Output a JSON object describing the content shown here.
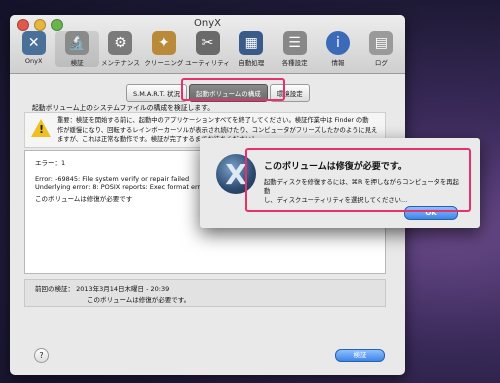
{
  "window": {
    "title": "OnyX"
  },
  "toolbar": {
    "items": [
      {
        "label": "OnyX",
        "icon": "onyx-logo-icon",
        "color": "#4a6f99"
      },
      {
        "label": "検証",
        "icon": "microscope-icon",
        "color": "#8a8a8a"
      },
      {
        "label": "メンテナンス",
        "icon": "gears-icon",
        "color": "#7a7a7a"
      },
      {
        "label": "クリーニング",
        "icon": "broom-icon",
        "color": "#b88a3a"
      },
      {
        "label": "ユーティリティ",
        "icon": "tools-icon",
        "color": "#6a6a6a"
      },
      {
        "label": "自動処理",
        "icon": "automation-icon",
        "color": "#3a5a8a"
      },
      {
        "label": "各種設定",
        "icon": "parameters-icon",
        "color": "#888888"
      },
      {
        "label": "情報",
        "icon": "info-icon",
        "color": "#3a6ab8"
      },
      {
        "label": "ログ",
        "icon": "log-icon",
        "color": "#9a9a9a"
      }
    ]
  },
  "tabs": [
    {
      "label": "S.M.A.R.T. 状況"
    },
    {
      "label": "起動ボリュームの構成"
    },
    {
      "label": "環境設定"
    }
  ],
  "description": "起動ボリューム上のシステムファイルの構成を検証します。",
  "warning": {
    "line1": "重要：検証を開始する前に、起動中のアプリケーションすべてを終了してください。検証作業中は Finder の動",
    "line2": "作が緩慢になり、回転するレインボーカーソルが表示され続けたり、コンピュータがフリーズしたかのように見え",
    "line3": "ますが、これは正常な動作です。検証が完了するまでお待ちください！"
  },
  "log": {
    "line1": "エラー：1",
    "line2": "Error: -69845: File system verify or repair failed",
    "line3": "Underlying error: 8: POSIX reports: Exec format error",
    "line4": "このボリュームは修復が必要です"
  },
  "status": {
    "line1": "前回の検証：  2013年3月14日木曜日 - 20:39",
    "line2": "このボリュームは修復が必要です。"
  },
  "buttons": {
    "help": "?",
    "verify": "検証",
    "ok": "OK"
  },
  "dialog": {
    "title": "このボリュームは修復が必要です。",
    "body_line1": "起動ディスクを修復するには、⌘R を押しながらコンピュータを再起動",
    "body_line2": "し、ディスクユーティリティを選択してください…",
    "icon_glyph": "X"
  },
  "colors": {
    "highlight": "#e8306a",
    "button_blue": "#3d86e6"
  }
}
